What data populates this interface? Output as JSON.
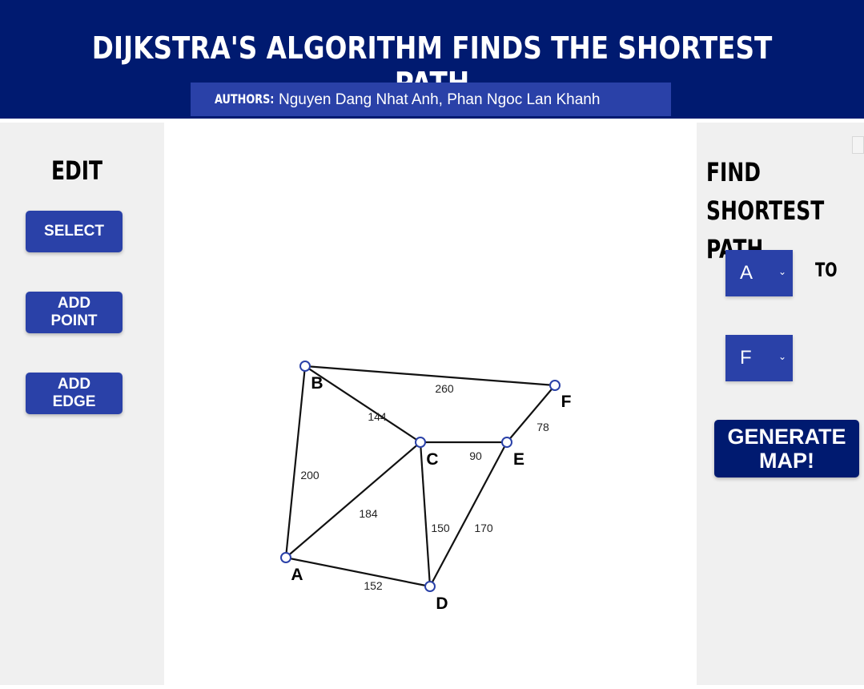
{
  "header": {
    "title": "DIJKSTRA'S ALGORITHM FINDS THE SHORTEST PATH",
    "authors_label": "AUTHORS:",
    "authors_names": "Nguyen Dang Nhat Anh, Phan Ngoc Lan Khanh"
  },
  "edit_panel": {
    "heading": "EDIT",
    "buttons": {
      "select": "SELECT",
      "add_point": "ADD POINT",
      "add_edge": "ADD EDGE"
    }
  },
  "path_panel": {
    "heading": "FIND SHORTEST PATH",
    "from_value": "A",
    "to_label": "TO",
    "to_value": "F",
    "generate_label": "GENERATE MAP!"
  },
  "graph": {
    "nodes": [
      {
        "id": "A",
        "label": "A"
      },
      {
        "id": "B",
        "label": "B"
      },
      {
        "id": "C",
        "label": "C"
      },
      {
        "id": "D",
        "label": "D"
      },
      {
        "id": "E",
        "label": "E"
      },
      {
        "id": "F",
        "label": "F"
      }
    ],
    "edges": [
      {
        "from": "B",
        "to": "F",
        "weight": "260"
      },
      {
        "from": "B",
        "to": "C",
        "weight": "144"
      },
      {
        "from": "B",
        "to": "A",
        "weight": "200"
      },
      {
        "from": "C",
        "to": "E",
        "weight": "90"
      },
      {
        "from": "E",
        "to": "F",
        "weight": "78"
      },
      {
        "from": "A",
        "to": "C",
        "weight": "184"
      },
      {
        "from": "C",
        "to": "D",
        "weight": "150"
      },
      {
        "from": "E",
        "to": "D",
        "weight": "170"
      },
      {
        "from": "A",
        "to": "D",
        "weight": "152"
      }
    ]
  },
  "colors": {
    "header_bg": "#001a70",
    "accent": "#2a41a8",
    "panel_bg": "#f0f0f0",
    "node_stroke": "#2a41a8"
  }
}
